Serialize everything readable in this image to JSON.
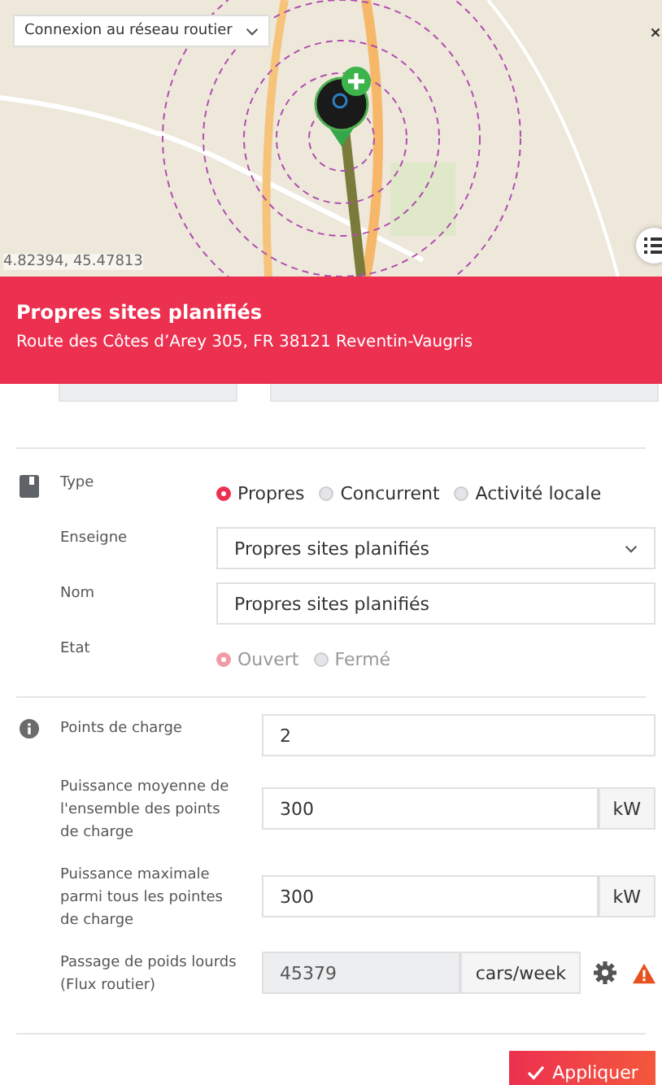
{
  "map": {
    "layer_select": "Connexion au réseau routier",
    "coordinates": "4.82394, 45.47813"
  },
  "banner": {
    "title": "Propres sites planifiés",
    "address": "Route des Côtes d’Arey 305, FR 38121 Reventin-Vaugris"
  },
  "type": {
    "label": "Type",
    "options": [
      {
        "label": "Propres",
        "selected": true
      },
      {
        "label": "Concurrent",
        "selected": false
      },
      {
        "label": "Activité locale",
        "selected": false
      }
    ]
  },
  "enseigne": {
    "label": "Enseigne",
    "value": "Propres sites planifiés"
  },
  "nom": {
    "label": "Nom",
    "value": "Propres sites planifiés"
  },
  "etat": {
    "label": "Etat",
    "disabled": true,
    "options": [
      {
        "label": "Ouvert",
        "selected": true
      },
      {
        "label": "Fermé",
        "selected": false
      }
    ]
  },
  "charging": [
    {
      "label": "Points de charge",
      "value": "2",
      "disabled": false
    },
    {
      "label": "Puissance moyenne de l'ensemble des points de charge",
      "value": "300",
      "unit": "kW",
      "disabled": false
    },
    {
      "label": "Puissance maximale parmi tous les pointes de charge",
      "value": "300",
      "unit": "kW",
      "disabled": false
    },
    {
      "label": "Passage de poids lourds (Flux routier)",
      "value": "45379",
      "unit": "cars/week",
      "disabled": true,
      "settings": true,
      "warning": true
    }
  ],
  "apply_button": "Appliquer"
}
